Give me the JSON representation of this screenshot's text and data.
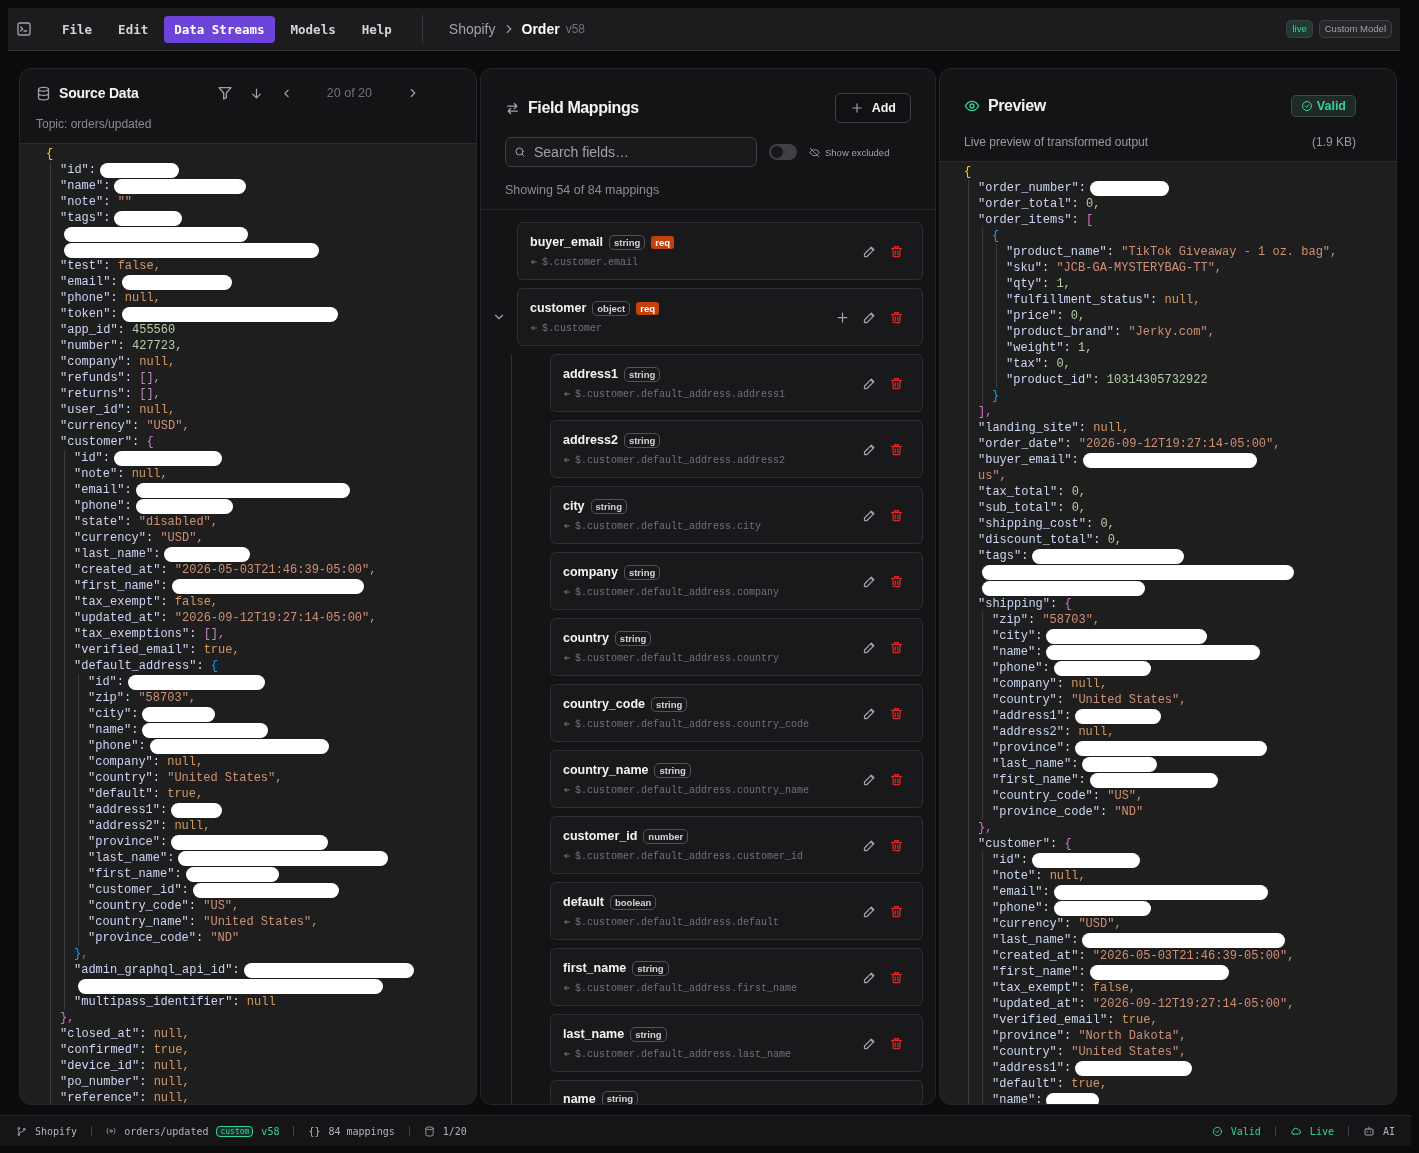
{
  "menu": {
    "items": [
      {
        "label": "File",
        "selected": false
      },
      {
        "label": "Edit",
        "selected": false
      },
      {
        "label": "Data Streams",
        "selected": true
      },
      {
        "label": "Models",
        "selected": false
      },
      {
        "label": "Help",
        "selected": false
      }
    ]
  },
  "breadcrumb": {
    "source": "Shopify",
    "entity": "Order",
    "version": "v58"
  },
  "badges": [
    {
      "label": "live",
      "kind": "status"
    },
    {
      "label": "Custom Model",
      "kind": "plain"
    }
  ],
  "source_panel": {
    "title": "Source Data",
    "pager": "20 of 20",
    "topic": "Topic: orders/updated",
    "code": [
      {
        "value": "{",
        "kind": "bracket",
        "children": [
          {
            "key": "\"id\":",
            "redacted": true
          },
          {
            "key": "\"name\":",
            "redacted": true
          },
          {
            "key": "\"note\":",
            "value": "\"\"",
            "kind": "string"
          },
          {
            "key": "\"tags\":",
            "redacted": true
          },
          {
            "redacted": true
          },
          {
            "redacted": true
          },
          {
            "key": "\"test\":",
            "value": "false,",
            "kind": "literal"
          },
          {
            "key": "\"email\":",
            "redacted": true
          },
          {
            "key": "\"phone\":",
            "value": "null,",
            "kind": "literal"
          },
          {
            "key": "\"token\":",
            "redacted": true
          },
          {
            "key": "\"app_id\":",
            "value": "455560",
            "kind": "number"
          },
          {
            "key": "\"number\":",
            "value": "427723,",
            "kind": "number"
          },
          {
            "key": "\"company\":",
            "value": "null,",
            "kind": "literal"
          },
          {
            "key": "\"refunds\":",
            "value": "[],",
            "kind": "array"
          },
          {
            "key": "\"returns\":",
            "value": "[],",
            "kind": "array"
          },
          {
            "key": "\"user_id\":",
            "value": "null,",
            "kind": "literal"
          },
          {
            "key": "\"currency\":",
            "value": "\"USD\",",
            "kind": "string"
          },
          {
            "key": "\"customer\":",
            "value": "{",
            "kind": "bracket",
            "close": "},",
            "children": [
              {
                "key": "\"id\":",
                "redacted": true
              },
              {
                "key": "\"note\":",
                "value": "null,",
                "kind": "literal"
              },
              {
                "key": "\"email\":",
                "redacted": true
              },
              {
                "key": "\"phone\":",
                "redacted": true
              },
              {
                "key": "\"state\":",
                "value": "\"disabled\",",
                "kind": "string"
              },
              {
                "key": "\"currency\":",
                "value": "\"USD\",",
                "kind": "string"
              },
              {
                "key": "\"last_name\":",
                "redacted": true
              },
              {
                "key": "\"created_at\":",
                "value": "\"2026-05-03T21:46:39-05:00\",",
                "kind": "string"
              },
              {
                "key": "\"first_name\":",
                "redacted": true
              },
              {
                "key": "\"tax_exempt\":",
                "value": "false,",
                "kind": "literal"
              },
              {
                "key": "\"updated_at\":",
                "value": "\"2026-09-12T19:27:14-05:00\",",
                "kind": "string"
              },
              {
                "key": "\"tax_exemptions\":",
                "value": "[],",
                "kind": "array"
              },
              {
                "key": "\"verified_email\":",
                "value": "true,",
                "kind": "literal"
              },
              {
                "key": "\"default_address\":",
                "value": "{",
                "kind": "bracket",
                "close": "},",
                "children": [
                  {
                    "key": "\"id\":",
                    "redacted": true
                  },
                  {
                    "key": "\"zip\":",
                    "value": "\"58703\",",
                    "kind": "string"
                  },
                  {
                    "key": "\"city\":",
                    "redacted": true
                  },
                  {
                    "key": "\"name\":",
                    "redacted": true
                  },
                  {
                    "key": "\"phone\":",
                    "redacted": true
                  },
                  {
                    "key": "\"company\":",
                    "value": "null,",
                    "kind": "literal"
                  },
                  {
                    "key": "\"country\":",
                    "value": "\"United States\",",
                    "kind": "string"
                  },
                  {
                    "key": "\"default\":",
                    "value": "true,",
                    "kind": "literal"
                  },
                  {
                    "key": "\"address1\":",
                    "redacted": true
                  },
                  {
                    "key": "\"address2\":",
                    "value": "null,",
                    "kind": "literal"
                  },
                  {
                    "key": "\"province\":",
                    "redacted": true
                  },
                  {
                    "key": "\"last_name\":",
                    "redacted": true
                  },
                  {
                    "key": "\"first_name\":",
                    "redacted": true
                  },
                  {
                    "key": "\"customer_id\":",
                    "redacted": true
                  },
                  {
                    "key": "\"country_code\":",
                    "value": "\"US\",",
                    "kind": "string"
                  },
                  {
                    "key": "\"country_name\":",
                    "value": "\"United States\",",
                    "kind": "string"
                  },
                  {
                    "key": "\"province_code\":",
                    "value": "\"ND\"",
                    "kind": "string"
                  }
                ]
              },
              {
                "key": "\"admin_graphql_api_id\":",
                "redacted": true
              },
              {
                "redacted": true
              },
              {
                "key": "\"multipass_identifier\":",
                "value": "null",
                "kind": "literal"
              }
            ]
          },
          {
            "key": "\"closed_at\":",
            "value": "null,",
            "kind": "literal"
          },
          {
            "key": "\"confirmed\":",
            "value": "true,",
            "kind": "literal"
          },
          {
            "key": "\"device_id\":",
            "value": "null,",
            "kind": "literal"
          },
          {
            "key": "\"po_number\":",
            "value": "null,",
            "kind": "literal"
          },
          {
            "key": "\"reference\":",
            "value": "null,",
            "kind": "literal"
          }
        ]
      }
    ]
  },
  "mappings_panel": {
    "title": "Field Mappings",
    "add_label": "Add",
    "search": {
      "placeholder": "Search fields…"
    },
    "show_excluded": {
      "label": "Show excluded",
      "on": false
    },
    "summary": "Showing 54 of 84 mappings",
    "items": [
      {
        "name": "buyer_email",
        "type": "string",
        "required_tag": "req",
        "path": "$.customer.email",
        "kind": "field"
      },
      {
        "name": "customer",
        "type": "object",
        "required_tag": "req",
        "path": "$.customer",
        "kind": "object",
        "expanded": true,
        "children": [
          {
            "name": "address1",
            "type": "string",
            "path": "$.customer.default_address.address1",
            "kind": "field"
          },
          {
            "name": "address2",
            "type": "string",
            "path": "$.customer.default_address.address2",
            "kind": "field"
          },
          {
            "name": "city",
            "type": "string",
            "path": "$.customer.default_address.city",
            "kind": "field"
          },
          {
            "name": "company",
            "type": "string",
            "path": "$.customer.default_address.company",
            "kind": "field"
          },
          {
            "name": "country",
            "type": "string",
            "path": "$.customer.default_address.country",
            "kind": "field"
          },
          {
            "name": "country_code",
            "type": "string",
            "path": "$.customer.default_address.country_code",
            "kind": "field"
          },
          {
            "name": "country_name",
            "type": "string",
            "path": "$.customer.default_address.country_name",
            "kind": "field"
          },
          {
            "name": "customer_id",
            "type": "number",
            "path": "$.customer.default_address.customer_id",
            "kind": "field"
          },
          {
            "name": "default",
            "type": "boolean",
            "path": "$.customer.default_address.default",
            "kind": "field"
          },
          {
            "name": "first_name",
            "type": "string",
            "path": "$.customer.default_address.first_name",
            "kind": "field"
          },
          {
            "name": "last_name",
            "type": "string",
            "path": "$.customer.default_address.last_name",
            "kind": "field"
          },
          {
            "name": "name",
            "type": "string",
            "kind": "cut"
          }
        ]
      }
    ]
  },
  "preview_panel": {
    "title": "Preview",
    "status": "Valid",
    "subtitle": "Live preview of transformed output",
    "size": "(1.9 KB)",
    "code": [
      {
        "value": "{",
        "kind": "bracket",
        "children": [
          {
            "key": "\"order_number\":",
            "redacted": true
          },
          {
            "key": "\"order_total\":",
            "value": "0,",
            "kind": "number"
          },
          {
            "key": "\"order_items\":",
            "value": "[",
            "kind": "bracket",
            "close": "],",
            "children": [
              {
                "value": "{",
                "kind": "bracket",
                "close": "}",
                "children": [
                  {
                    "key": "\"product_name\":",
                    "value": "\"TikTok Giveaway - 1 oz. bag\",",
                    "kind": "string"
                  },
                  {
                    "key": "\"sku\":",
                    "value": "\"JCB-GA-MYSTERYBAG-TT\",",
                    "kind": "string"
                  },
                  {
                    "key": "\"qty\":",
                    "value": "1,",
                    "kind": "number"
                  },
                  {
                    "key": "\"fulfillment_status\":",
                    "value": "null,",
                    "kind": "literal"
                  },
                  {
                    "key": "\"price\":",
                    "value": "0,",
                    "kind": "number"
                  },
                  {
                    "key": "\"product_brand\":",
                    "value": "\"Jerky.com\",",
                    "kind": "string"
                  },
                  {
                    "key": "\"weight\":",
                    "value": "1,",
                    "kind": "number"
                  },
                  {
                    "key": "\"tax\":",
                    "value": "0,",
                    "kind": "number"
                  },
                  {
                    "key": "\"product_id\":",
                    "value": "10314305732922",
                    "kind": "number"
                  }
                ]
              }
            ]
          },
          {
            "key": "\"landing_site\":",
            "value": "null,",
            "kind": "literal"
          },
          {
            "key": "\"order_date\":",
            "value": "\"2026-09-12T19:27:14-05:00\",",
            "kind": "string"
          },
          {
            "key": "\"buyer_email\":",
            "redacted": true
          },
          {
            "value": "us\",",
            "kind": "string"
          },
          {
            "key": "\"tax_total\":",
            "value": "0,",
            "kind": "number"
          },
          {
            "key": "\"sub_total\":",
            "value": "0,",
            "kind": "number"
          },
          {
            "key": "\"shipping_cost\":",
            "value": "0,",
            "kind": "number"
          },
          {
            "key": "\"discount_total\":",
            "value": "0,",
            "kind": "number"
          },
          {
            "key": "\"tags\":",
            "redacted": true
          },
          {
            "redacted": true
          },
          {
            "redacted": true
          },
          {
            "key": "\"shipping\":",
            "value": "{",
            "kind": "bracket",
            "close": "},",
            "children": [
              {
                "key": "\"zip\":",
                "value": "\"58703\",",
                "kind": "string"
              },
              {
                "key": "\"city\":",
                "redacted": true
              },
              {
                "key": "\"name\":",
                "redacted": true
              },
              {
                "key": "\"phone\":",
                "redacted": true
              },
              {
                "key": "\"company\":",
                "value": "null,",
                "kind": "literal"
              },
              {
                "key": "\"country\":",
                "value": "\"United States\",",
                "kind": "string"
              },
              {
                "key": "\"address1\":",
                "redacted": true
              },
              {
                "key": "\"address2\":",
                "value": "null,",
                "kind": "literal"
              },
              {
                "key": "\"province\":",
                "redacted": true
              },
              {
                "key": "\"last_name\":",
                "redacted": true
              },
              {
                "key": "\"first_name\":",
                "redacted": true
              },
              {
                "key": "\"country_code\":",
                "value": "\"US\",",
                "kind": "string"
              },
              {
                "key": "\"province_code\":",
                "value": "\"ND\"",
                "kind": "string"
              }
            ]
          },
          {
            "key": "\"customer\":",
            "value": "{",
            "kind": "bracket",
            "children": [
              {
                "key": "\"id\":",
                "redacted": true
              },
              {
                "key": "\"note\":",
                "value": "null,",
                "kind": "literal"
              },
              {
                "key": "\"email\":",
                "redacted": true
              },
              {
                "key": "\"phone\":",
                "redacted": true
              },
              {
                "key": "\"currency\":",
                "value": "\"USD\",",
                "kind": "string"
              },
              {
                "key": "\"last_name\":",
                "redacted": true
              },
              {
                "key": "\"created_at\":",
                "value": "\"2026-05-03T21:46:39-05:00\",",
                "kind": "string"
              },
              {
                "key": "\"first_name\":",
                "redacted": true
              },
              {
                "key": "\"tax_exempt\":",
                "value": "false,",
                "kind": "literal"
              },
              {
                "key": "\"updated_at\":",
                "value": "\"2026-09-12T19:27:14-05:00\",",
                "kind": "string"
              },
              {
                "key": "\"verified_email\":",
                "value": "true,",
                "kind": "literal"
              },
              {
                "key": "\"province\":",
                "value": "\"North Dakota\",",
                "kind": "string"
              },
              {
                "key": "\"country\":",
                "value": "\"United States\",",
                "kind": "string"
              },
              {
                "key": "\"address1\":",
                "redacted": true
              },
              {
                "key": "\"default\":",
                "value": "true,",
                "kind": "literal"
              },
              {
                "key": "\"name\":",
                "redacted": true
              }
            ]
          }
        ]
      }
    ]
  },
  "status_bar": {
    "source": "Shopify",
    "topic": "orders/updated",
    "tag": "custom",
    "version": "v58",
    "mappings_mark": "{}",
    "mappings": "84 mappings",
    "page": "1/20",
    "valid": "Valid",
    "live": "Live",
    "ai": "AI"
  }
}
